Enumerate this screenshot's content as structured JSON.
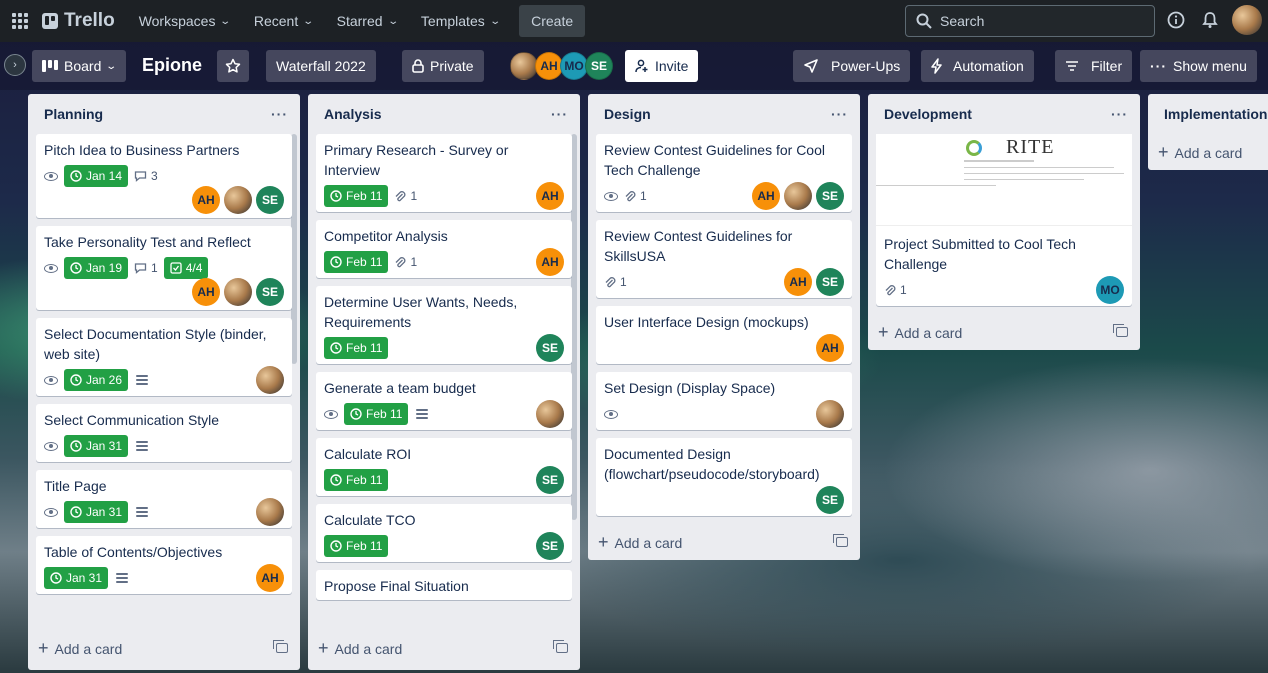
{
  "topnav": {
    "logo": "Trello",
    "items": [
      "Workspaces",
      "Recent",
      "Starred",
      "Templates"
    ],
    "create": "Create",
    "search_placeholder": "Search"
  },
  "board": {
    "view": "Board",
    "name": "Epione",
    "workspace": "Waterfall 2022",
    "visibility": "Private",
    "members": [
      "AH",
      "MO",
      "SE"
    ],
    "invite": "Invite",
    "power_ups": "Power-Ups",
    "automation": "Automation",
    "filter": "Filter",
    "show_menu": "Show menu"
  },
  "add_card": "Add a card",
  "lists": [
    {
      "title": "Planning",
      "cards": [
        {
          "title": "Pitch Idea to Business Partners",
          "watch": true,
          "due": "Jan 14",
          "comments": "3",
          "members": [
            "AH",
            "photo",
            "SE"
          ]
        },
        {
          "title": "Take Personality Test and Reflect",
          "watch": true,
          "due": "Jan 19",
          "comments": "1",
          "checklist": "4/4",
          "members": [
            "AH",
            "photo",
            "SE"
          ]
        },
        {
          "title": "Select Documentation Style (binder, web site)",
          "watch": true,
          "due": "Jan 26",
          "desc": true,
          "members": [
            "photo"
          ]
        },
        {
          "title": "Select Communication Style",
          "watch": true,
          "due": "Jan 31",
          "desc": true,
          "members": []
        },
        {
          "title": "Title Page",
          "watch": true,
          "due": "Jan 31",
          "desc": true,
          "members": [
            "photo"
          ]
        },
        {
          "title": "Table of Contents/Objectives",
          "due": "Jan 31",
          "desc": true,
          "members": [
            "AH"
          ]
        }
      ]
    },
    {
      "title": "Analysis",
      "cards": [
        {
          "title": "Primary Research - Survey or Interview",
          "due": "Feb 11",
          "attachments": "1",
          "members": [
            "AH"
          ]
        },
        {
          "title": "Competitor Analysis",
          "due": "Feb 11",
          "attachments": "1",
          "members": [
            "AH"
          ]
        },
        {
          "title": "Determine User Wants, Needs, Requirements",
          "due": "Feb 11",
          "members": [
            "SE"
          ]
        },
        {
          "title": "Generate a team budget",
          "watch": true,
          "due": "Feb 11",
          "desc": true,
          "members": [
            "photo"
          ]
        },
        {
          "title": "Calculate ROI",
          "due": "Feb 11",
          "members": [
            "SE"
          ]
        },
        {
          "title": "Calculate TCO",
          "due": "Feb 11",
          "members": [
            "SE"
          ]
        },
        {
          "title": "Propose Final Situation",
          "members": []
        }
      ]
    },
    {
      "title": "Design",
      "cards": [
        {
          "title": "Review Contest Guidelines for Cool Tech Challenge",
          "watch": true,
          "attachments": "1",
          "members": [
            "AH",
            "photo",
            "SE"
          ]
        },
        {
          "title": "Review Contest Guidelines for SkillsUSA",
          "attachments": "1",
          "members": [
            "AH",
            "SE"
          ]
        },
        {
          "title": "User Interface Design (mockups)",
          "members": [
            "AH"
          ]
        },
        {
          "title": "Set Design (Display Space)",
          "watch": true,
          "members": [
            "photo"
          ]
        },
        {
          "title": "Documented Design (flowchart/pseudocode/storyboard)",
          "members": [
            "SE"
          ]
        }
      ]
    },
    {
      "title": "Development",
      "cards": [
        {
          "title": "Project Submitted to Cool Tech Challenge",
          "cover": "RITE",
          "attachments": "1",
          "members": [
            "MO"
          ]
        }
      ]
    },
    {
      "title": "Implementation",
      "cards": []
    }
  ]
}
